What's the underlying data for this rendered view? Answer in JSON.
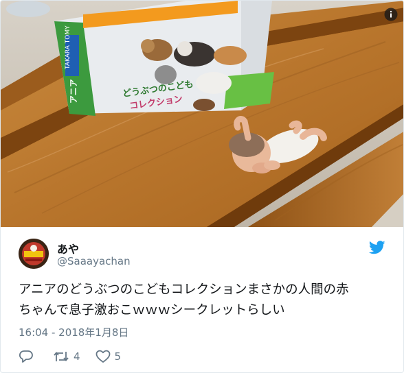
{
  "tweet": {
    "display_name": "あや",
    "handle": "@Saaayachan",
    "text_line1": "アニアのどうぶつのこどもコレクションまさかの人間の赤",
    "text_line2": "ちゃんで息子激おこｗｗｗシークレットらしい",
    "timestamp": "16:04 - 2018年1月8日",
    "retweet_count": "4",
    "like_count": "5"
  },
  "photo": {
    "box_brand": "TAKARA TOMY",
    "box_series": "アニア",
    "box_title_line1": "どうぶつのこども",
    "box_title_line2": "コレクション"
  },
  "icons": {
    "info": "info-icon",
    "twitter": "twitter-bird-icon",
    "reply": "reply-icon",
    "retweet": "retweet-icon",
    "like": "heart-icon"
  },
  "colors": {
    "text": "#14171a",
    "secondary": "#657786",
    "twitter_blue": "#1da1f2",
    "border": "#e1e8ed"
  }
}
